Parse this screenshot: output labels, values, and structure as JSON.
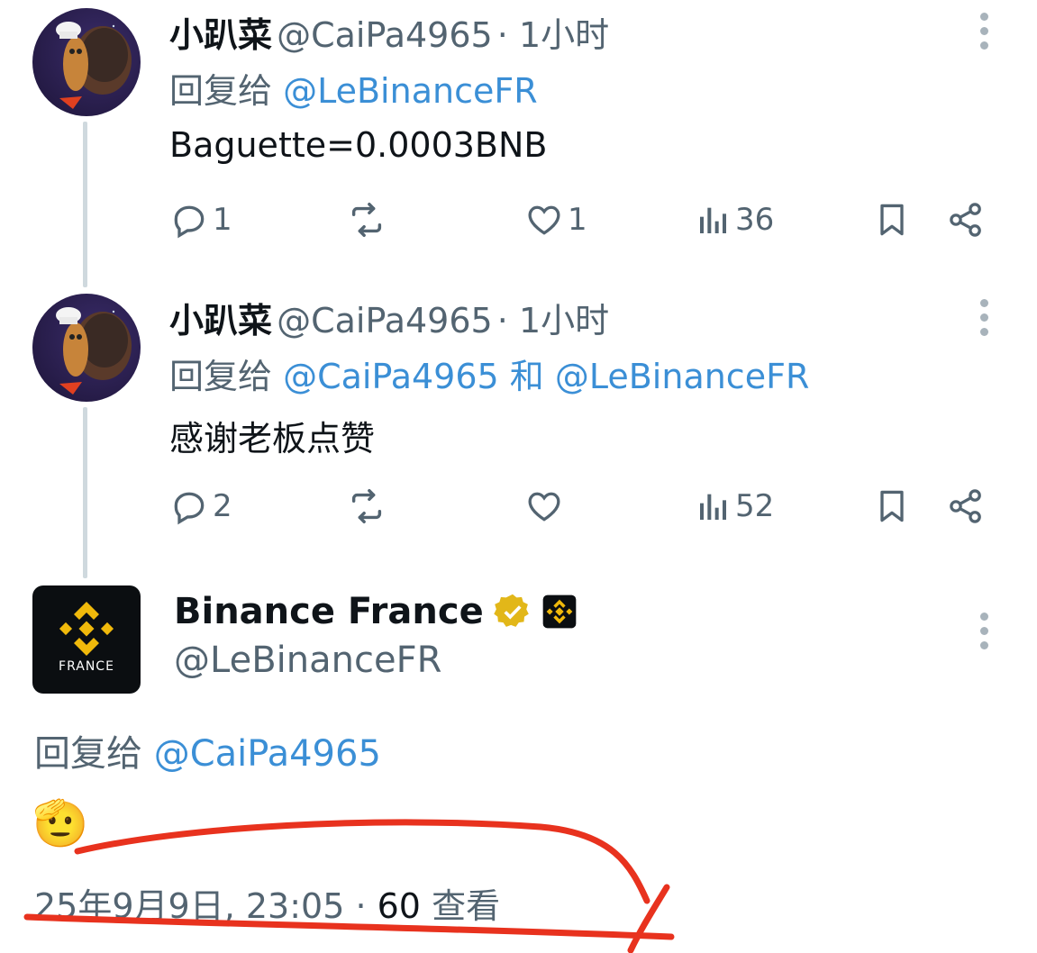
{
  "tweets": [
    {
      "author": "小趴菜",
      "handle": "@CaiPa4965",
      "time": "· 1小时",
      "reply_prefix": "回复给",
      "reply_to": "@LeBinanceFR",
      "text": "Baguette=0.0003BNB",
      "replies": "1",
      "retweets": "",
      "likes": "1",
      "views": "36"
    },
    {
      "author": "小趴菜",
      "handle": "@CaiPa4965",
      "time": "· 1小时",
      "reply_prefix": "回复给",
      "reply_to": "@CaiPa4965 和 @LeBinanceFR",
      "text": "感谢老板点赞",
      "replies": "2",
      "retweets": "",
      "likes": "",
      "views": "52"
    }
  ],
  "main_tweet": {
    "author": "Binance France",
    "handle": "@LeBinanceFR",
    "avatar_label": "FRANCE",
    "reply_prefix": "回复给",
    "reply_to": "@CaiPa4965",
    "emoji": "🫡",
    "timestamp": "25年9月9日, 23:05 · ",
    "views_count": "60",
    "views_label": " 查看"
  },
  "colors": {
    "link": "#3b8fd6",
    "muted": "#536471",
    "verified_gold": "#e2b719",
    "annotation_red": "#e8321e"
  }
}
